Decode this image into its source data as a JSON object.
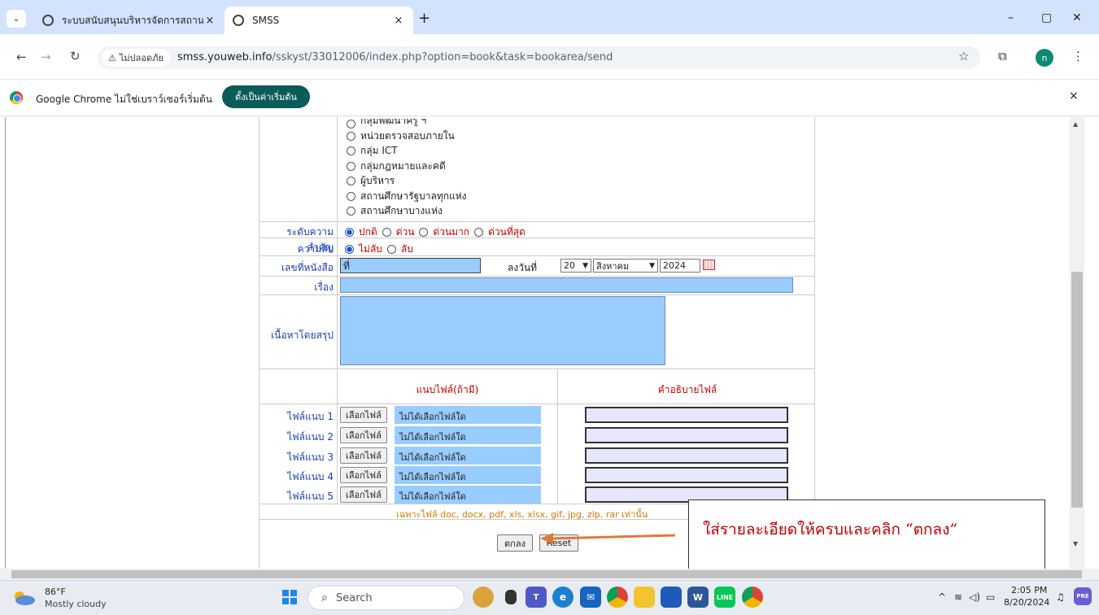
{
  "browser": {
    "tabs": [
      {
        "title": "ระบบสนับสนุนบริหารจัดการสถานศึกษ",
        "close": "×"
      },
      {
        "title": "SMSS",
        "close": "×"
      }
    ],
    "new_tab": "+",
    "window": {
      "minimize": "–",
      "restore": "▢",
      "close": "✕"
    },
    "security_label": "ไม่ปลอดภัย",
    "url_host": "smss.youweb.info",
    "url_path": "/sskyst/33012006/index.php?option=book&task=bookarea/send",
    "profile_initial": "n",
    "infobar": {
      "text": "Google Chrome ไม่ใช่เบราว์เซอร์เริ่มต้น",
      "button": "ตั้งเป็นค่าเริ่มต้น",
      "close": "×"
    }
  },
  "form": {
    "departments": [
      "กลุ่มพัฒนาครู ฯ",
      "หน่วยตรวจสอบภายใน",
      "กลุ่ม ICT",
      "กลุ่มกฎหมายและคดี",
      "ผู้บริหาร",
      "สถานศึกษารัฐบาลทุกแห่ง",
      "สถานศึกษาบางแห่ง"
    ],
    "priority": {
      "label": "ระดับความสำคัญ",
      "options": [
        "ปกติ",
        "ด่วน",
        "ด่วนมาก",
        "ด่วนที่สุด"
      ],
      "selected": "ปกติ"
    },
    "secrecy": {
      "label": "ความลับ",
      "options": [
        "ไม่ลับ",
        "ลับ"
      ],
      "selected": "ไม่ลับ"
    },
    "doc_number": {
      "label": "เลขที่หนังสือ",
      "value": "ที่"
    },
    "date": {
      "label": "ลงวันที่",
      "day": "20",
      "month": "สิงหาคม",
      "year": "2024"
    },
    "subject": {
      "label": "เรื่อง",
      "value": ""
    },
    "summary": {
      "label": "เนื้อหาโดยสรุป",
      "value": ""
    },
    "attach_header": "แนบไฟล์(ถ้ามี)",
    "desc_header": "คำอธิบายไฟล์",
    "files": [
      {
        "label": "ไฟล์แนบ 1",
        "button": "เลือกไฟล์",
        "status": "ไม่ได้เลือกไฟล์ใด"
      },
      {
        "label": "ไฟล์แนบ 2",
        "button": "เลือกไฟล์",
        "status": "ไม่ได้เลือกไฟล์ใด"
      },
      {
        "label": "ไฟล์แนบ 3",
        "button": "เลือกไฟล์",
        "status": "ไม่ได้เลือกไฟล์ใด"
      },
      {
        "label": "ไฟล์แนบ 4",
        "button": "เลือกไฟล์",
        "status": "ไม่ได้เลือกไฟล์ใด"
      },
      {
        "label": "ไฟล์แนบ 5",
        "button": "เลือกไฟล์",
        "status": "ไม่ได้เลือกไฟล์ใด"
      }
    ],
    "file_note": "เฉพาะไฟล์ doc, docx, pdf, xls, xlsx, gif, jpg, zip, rar เท่านั้น",
    "submit_label": "ตกลง",
    "reset_label": "Reset"
  },
  "annotation": {
    "text": "ใส่รายละเอียดให้ครบและคลิก “ตกลง”",
    "color": "#c00000"
  },
  "taskbar": {
    "weather_temp": "86°F",
    "weather_desc": "Mostly cloudy",
    "search_placeholder": "Search",
    "time": "2:05 PM",
    "date": "8/20/2024"
  }
}
